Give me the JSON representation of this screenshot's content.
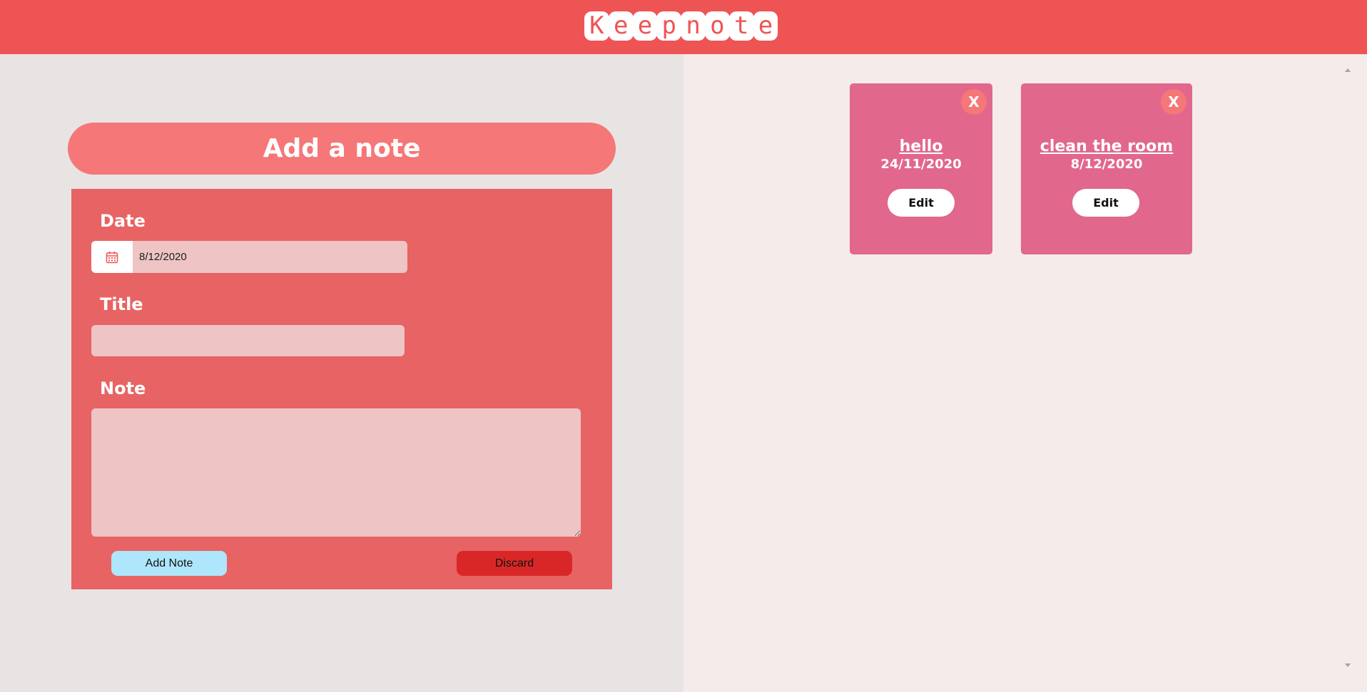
{
  "header": {
    "logo_letters": [
      "K",
      "e",
      "e",
      "p",
      "n",
      "o",
      "t",
      "e"
    ]
  },
  "form": {
    "heading": "Add a note",
    "date_label": "Date",
    "date_value": "8/12/2020",
    "title_label": "Title",
    "title_value": "",
    "note_label": "Note",
    "note_value": "",
    "add_button": "Add Note",
    "discard_button": "Discard"
  },
  "notes": [
    {
      "title": "hello",
      "date": "24/11/2020",
      "close_label": "X",
      "edit_label": "Edit"
    },
    {
      "title": "clean the room",
      "date": "8/12/2020",
      "close_label": "X",
      "edit_label": "Edit"
    }
  ],
  "colors": {
    "header_bg": "#ef5455",
    "left_bg": "#e9e4e4",
    "right_bg": "#f4ebea",
    "heading_bg": "#f57777",
    "form_bg": "#e86363",
    "input_bg": "#eec4c5",
    "card_bg": "#e2678c",
    "add_button_bg": "#aee6fb",
    "discard_button_bg": "#d92727"
  },
  "icons": {
    "date_picker": "calendar-icon",
    "scroll_up": "scroll-up-arrow-icon",
    "scroll_down": "scroll-down-arrow-icon"
  }
}
